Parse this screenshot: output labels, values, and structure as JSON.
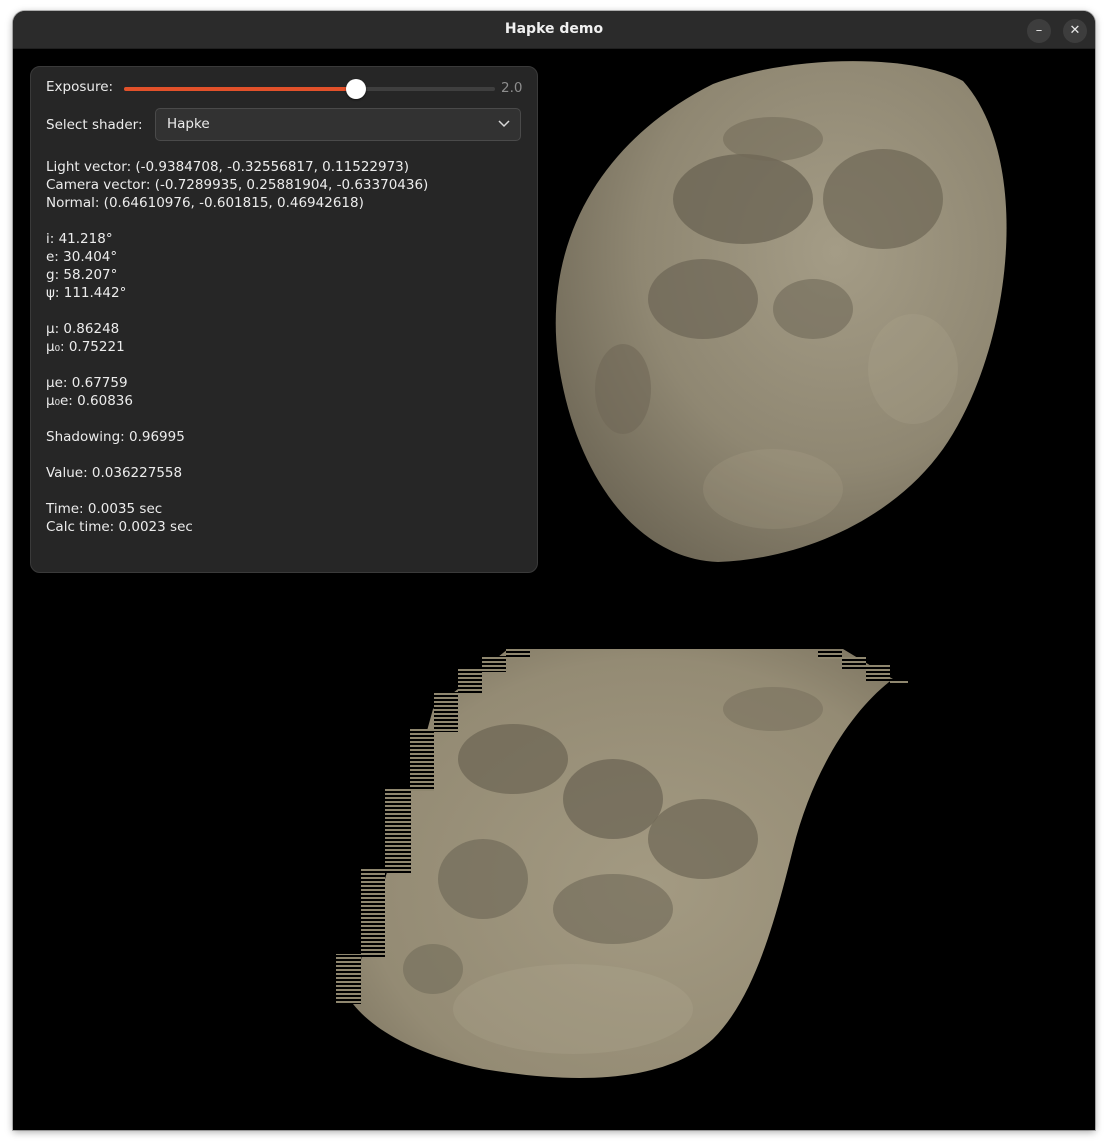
{
  "window": {
    "title": "Hapke demo",
    "minimize_glyph": "–",
    "close_glyph": "✕"
  },
  "controls": {
    "exposure_label": "Exposure:",
    "exposure_value": "2.0",
    "exposure_fraction": 0.625,
    "shader_label": "Select shader:",
    "shader_selected": "Hapke",
    "accent_color": "#e2512a"
  },
  "info": {
    "light_vector": "Light vector: (-0.9384708, -0.32556817, 0.11522973)",
    "camera_vector": "Camera vector: (-0.7289935, 0.25881904, -0.63370436)",
    "normal": "Normal: (0.64610976, -0.601815, 0.46942618)",
    "i": "i: 41.218°",
    "e": "e: 30.404°",
    "g": "g: 58.207°",
    "psi": "ψ: 111.442°",
    "mu": "μ: 0.86248",
    "mu0": "μ₀: 0.75221",
    "mue": "μe: 0.67759",
    "mu0e": "μ₀e: 0.60836",
    "shadowing": "Shadowing: 0.96995",
    "value": "Value: 0.036227558",
    "time": "Time: 0.0035 sec",
    "calc_time": "Calc time: 0.0023 sec"
  },
  "icons": {
    "dropdown": "chevron-down-icon",
    "minimize": "minimize-icon",
    "close": "close-icon"
  }
}
